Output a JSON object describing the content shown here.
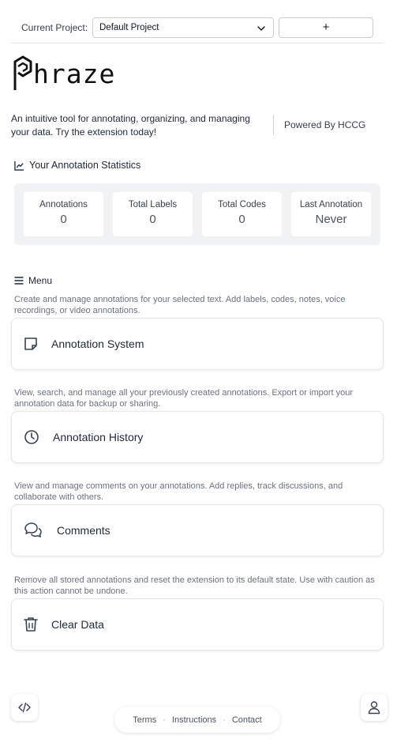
{
  "project": {
    "label": "Current Project:",
    "selected": "Default Project",
    "add_button_label": "+"
  },
  "logo": {
    "text": "hraze"
  },
  "intro": {
    "description": "An intuitive tool for annotating, organizing, and managing your data. Try the extension today!",
    "powered_by": "Powered By HCCG"
  },
  "stats": {
    "heading": "Your Annotation Statistics",
    "items": [
      {
        "label": "Annotations",
        "value": "0"
      },
      {
        "label": "Total Labels",
        "value": "0"
      },
      {
        "label": "Total Codes",
        "value": "0"
      },
      {
        "label": "Last Annotation",
        "value": "Never"
      }
    ]
  },
  "menu": {
    "heading": "Menu",
    "items": [
      {
        "description": "Create and manage annotations for your selected text. Add labels, codes, notes, voice recordings, or video annotations.",
        "label": "Annotation System",
        "icon": "sticky-note-icon"
      },
      {
        "description": "View, search, and manage all your previously created annotations. Export or import your annotation data for backup or sharing.",
        "label": "Annotation History",
        "icon": "clock-icon"
      },
      {
        "description": "View and manage comments on your annotations. Add replies, track discussions, and collaborate with others.",
        "label": "Comments",
        "icon": "chat-bubbles-icon"
      },
      {
        "description": "Remove all stored annotations and reset the extension to its default state. Use with caution as this action cannot be undone.",
        "label": "Clear Data",
        "icon": "trash-icon"
      }
    ]
  },
  "footer": {
    "terms": "Terms",
    "instructions": "Instructions",
    "contact": "Contact",
    "separator": "·"
  },
  "colors": {
    "text": "#1f2937",
    "muted": "#6b7280",
    "panel": "#f1f2f4",
    "border": "#e5e7eb"
  }
}
